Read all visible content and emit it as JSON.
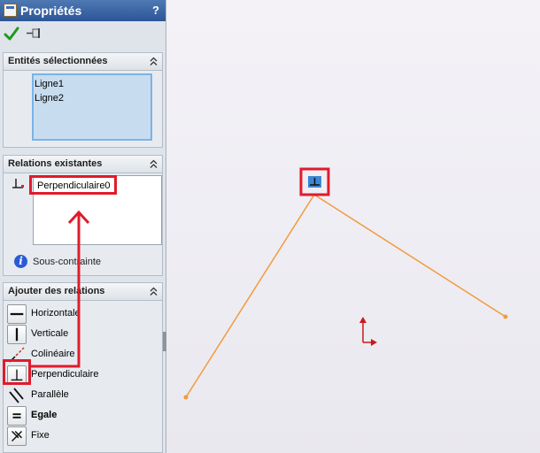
{
  "panel": {
    "title": "Propriétés",
    "help": "?",
    "toolbar": {
      "ok_icon": "checkmark-icon",
      "pin_icon": "pushpin-icon"
    }
  },
  "entities": {
    "title": "Entités sélectionnées",
    "items": [
      "Ligne1",
      "Ligne2"
    ]
  },
  "relations": {
    "title": "Relations existantes",
    "items": [
      "Perpendiculaire0"
    ],
    "status": "Sous-contrainte"
  },
  "add_relations": {
    "title": "Ajouter des relations",
    "items": [
      {
        "label": "Horizontale",
        "icon": "horizontal-relation-icon"
      },
      {
        "label": "Verticale",
        "icon": "vertical-relation-icon"
      },
      {
        "label": "Colinéaire",
        "icon": "collinear-relation-icon"
      },
      {
        "label": "Perpendiculaire",
        "icon": "perpendicular-relation-icon"
      },
      {
        "label": "Parallèle",
        "icon": "parallel-relation-icon"
      },
      {
        "label": "Egale",
        "icon": "equal-relation-icon"
      },
      {
        "label": "Fixe",
        "icon": "fix-relation-icon"
      }
    ]
  },
  "colors": {
    "sketch_line": "#f39a3c",
    "annotation": "#e01b2b",
    "titlebar": "#3a66a8",
    "selection": "#c8dcf0"
  }
}
